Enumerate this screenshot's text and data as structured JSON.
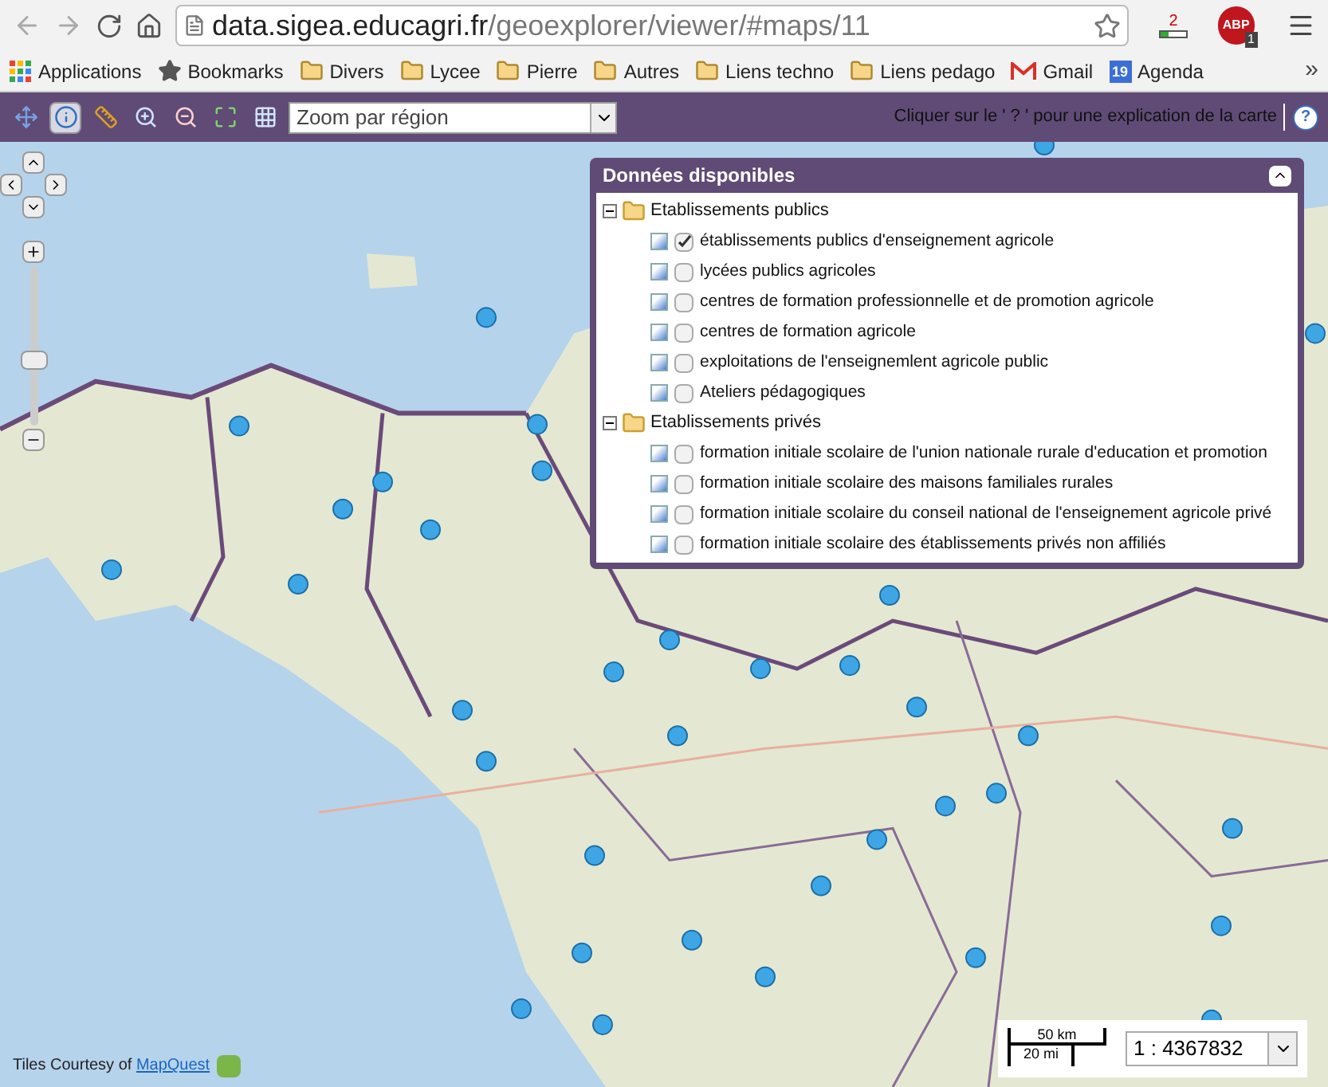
{
  "browser": {
    "address_domain": "data.sigea.educagri.fr",
    "address_path": "/geoexplorer/viewer/#maps/11",
    "extension_count": "2",
    "adblock_label": "ABP",
    "adblock_count": "1",
    "bookmarks": [
      {
        "kind": "apps",
        "label": "Applications"
      },
      {
        "kind": "star",
        "label": "Bookmarks"
      },
      {
        "kind": "folder",
        "label": "Divers"
      },
      {
        "kind": "folder",
        "label": "Lycee"
      },
      {
        "kind": "folder",
        "label": "Pierre"
      },
      {
        "kind": "folder",
        "label": "Autres"
      },
      {
        "kind": "folder",
        "label": "Liens techno"
      },
      {
        "kind": "folder",
        "label": "Liens pedago"
      },
      {
        "kind": "gmail",
        "label": "Gmail"
      },
      {
        "kind": "calendar",
        "label": "Agenda",
        "icon_text": "19"
      }
    ],
    "more": "»"
  },
  "toolbar": {
    "tools": [
      {
        "kind": "pan",
        "selected": false
      },
      {
        "kind": "info",
        "selected": true
      },
      {
        "kind": "measure",
        "selected": false
      },
      {
        "kind": "zoom-in",
        "selected": false
      },
      {
        "kind": "zoom-out",
        "selected": false
      },
      {
        "kind": "extent",
        "selected": false
      },
      {
        "kind": "grid",
        "selected": false
      }
    ],
    "zoom_select": {
      "value": "Zoom par région"
    },
    "hint": "Cliquer sur le ' ? ' pour une explication de la carte",
    "help": "?"
  },
  "map": {
    "zoom_slider": {
      "level": 0.4
    },
    "attribution": "Tiles Courtesy of",
    "attribution_link": "MapQuest",
    "scale_km": "50 km",
    "scale_mi": "20 mi",
    "scale_select": "1 : 4367832"
  },
  "layers_panel": {
    "title": "Données disponibles",
    "groups": [
      {
        "label": "Etablissements publics",
        "expanded": true,
        "children": [
          {
            "label": "établissements publics d'enseignement agricole",
            "checked": true
          },
          {
            "label": "lycées publics agricoles",
            "checked": false
          },
          {
            "label": "centres de formation professionnelle et de promotion agricole",
            "checked": false
          },
          {
            "label": "centres de formation agricole",
            "checked": false
          },
          {
            "label": "exploitations de l'enseignemlent agricole public",
            "checked": false
          },
          {
            "label": "Ateliers pédagogiques",
            "checked": false
          }
        ]
      },
      {
        "label": "Etablissements privés",
        "expanded": true,
        "children": [
          {
            "label": "formation initiale scolaire de l'union nationale rurale d'education et promotion",
            "checked": false
          },
          {
            "label": "formation initiale scolaire des maisons familiales rurales",
            "checked": false
          },
          {
            "label": "formation initiale scolaire du conseil national de l'enseignement agricole privé",
            "checked": false
          },
          {
            "label": "formation initiale scolaire des établissements privés non affiliés",
            "checked": false
          }
        ]
      }
    ]
  }
}
